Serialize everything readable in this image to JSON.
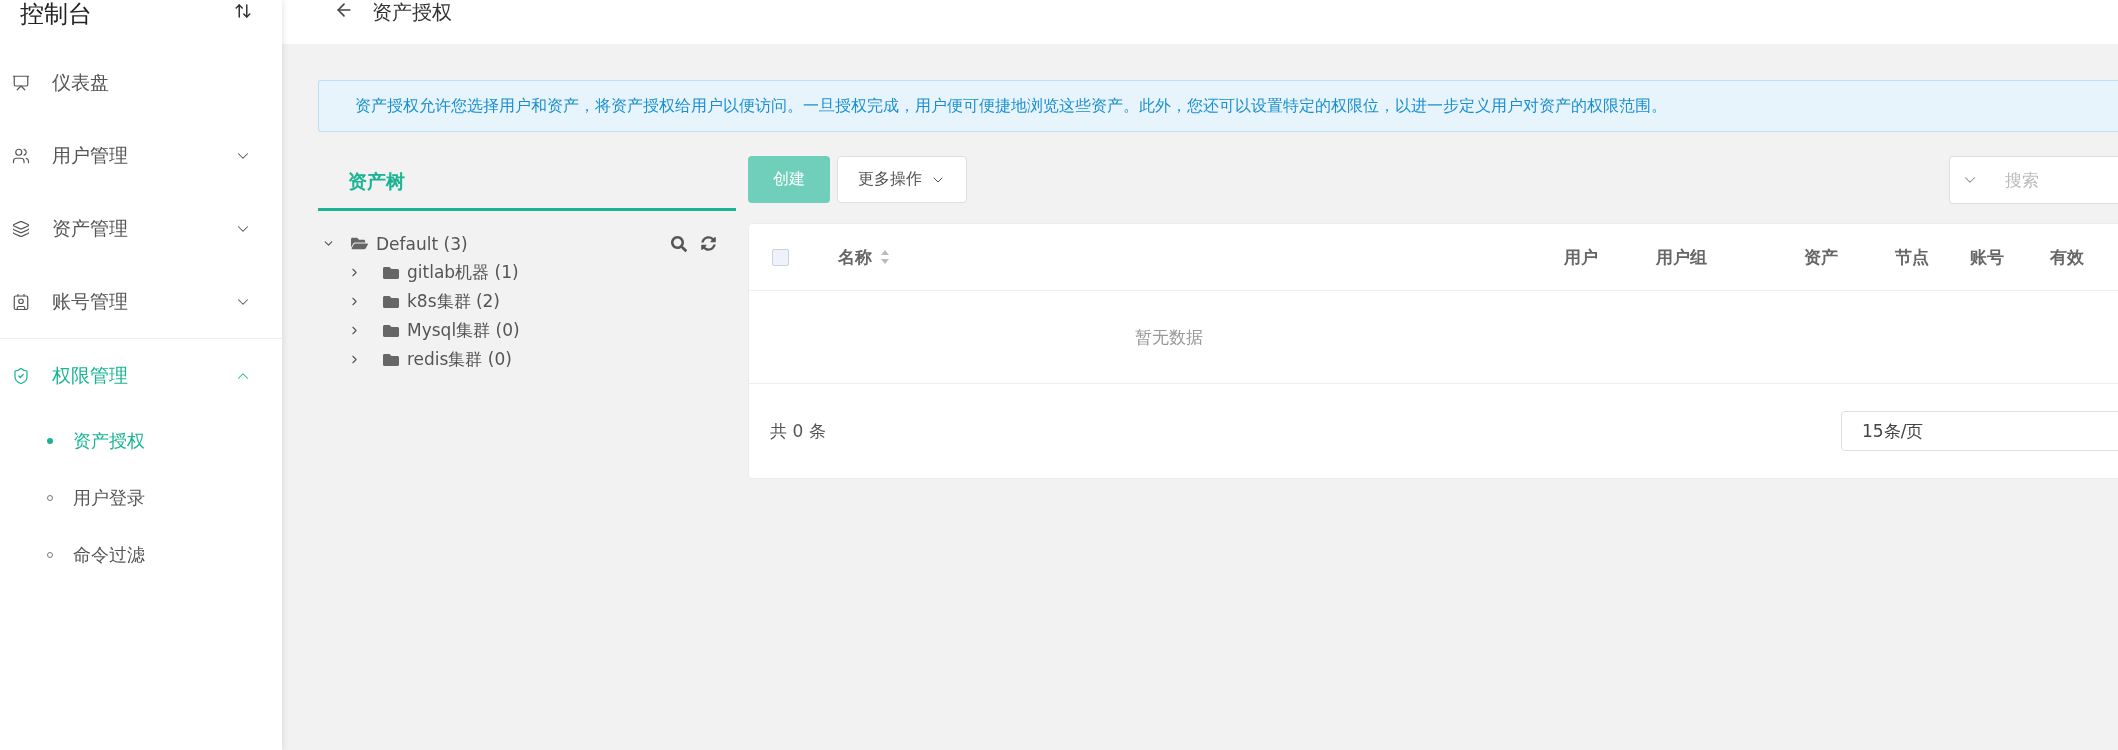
{
  "sidebar": {
    "title": "控制台",
    "menu": [
      {
        "label": "仪表盘",
        "selected": false
      },
      {
        "label": "用户管理",
        "selected": false,
        "expanded": false
      },
      {
        "label": "资产管理",
        "selected": false,
        "expanded": false
      },
      {
        "label": "账号管理",
        "selected": false,
        "expanded": false
      },
      {
        "label": "权限管理",
        "selected": true,
        "expanded": true,
        "children": [
          {
            "label": "资产授权",
            "selected": true
          },
          {
            "label": "用户登录",
            "selected": false
          },
          {
            "label": "命令过滤",
            "selected": false
          }
        ]
      }
    ]
  },
  "header": {
    "title": "资产授权"
  },
  "banner": "资产授权允许您选择用户和资产，将资产授权给用户以便访问。一旦授权完成，用户便可便捷地浏览这些资产。此外，您还可以设置特定的权限位，以进一步定义用户对资产的权限范围。",
  "tree_tabs": [
    {
      "label": "资产树",
      "selected": true
    }
  ],
  "tree": {
    "label": "Default (3)",
    "expanded": true,
    "children": [
      {
        "label": "gitlab机器 (1)",
        "expanded": false
      },
      {
        "label": "k8s集群 (2)",
        "expanded": false
      },
      {
        "label": "Mysql集群 (0)",
        "expanded": false
      },
      {
        "label": "redis集群 (0)",
        "expanded": false
      }
    ]
  },
  "toolbar": {
    "create": "创建",
    "more": "更多操作",
    "search": {
      "placeholder": "搜索"
    }
  },
  "table": {
    "select_all": {
      "checked": false
    },
    "columns": [
      {
        "label": "名称",
        "sortable": true
      },
      {
        "label": "用户",
        "sortable": false
      },
      {
        "label": "用户组",
        "sortable": false
      },
      {
        "label": "资产",
        "sortable": false
      },
      {
        "label": "节点",
        "sortable": false
      },
      {
        "label": "账号",
        "sortable": false
      },
      {
        "label": "有效",
        "sortable": false
      }
    ],
    "empty_text": "暂无数据",
    "total": "共 0 条",
    "page_size": "15条/页"
  }
}
